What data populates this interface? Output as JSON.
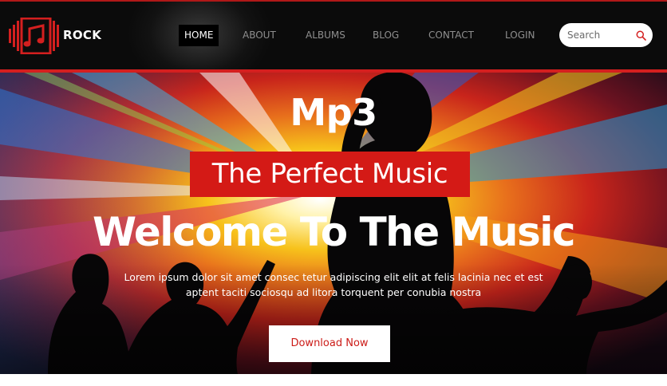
{
  "brand": {
    "name": "ROCK",
    "accent_color": "#d41f1f",
    "logo_icon": "music-note-icon"
  },
  "nav": {
    "items": [
      {
        "label": "HOME",
        "active": true
      },
      {
        "label": "ABOUT",
        "active": false
      },
      {
        "label": "ALBUMS",
        "active": false
      },
      {
        "label": "BLOG",
        "active": false
      },
      {
        "label": "CONTACT",
        "active": false
      },
      {
        "label": "LOGIN",
        "active": false
      }
    ]
  },
  "search": {
    "placeholder": "Search",
    "value": "",
    "icon": "search-icon"
  },
  "hero": {
    "title_small": "Mp3",
    "tagline": "The Perfect Music",
    "heading": "Welcome To The Music",
    "text_line1": "Lorem ipsum dolor sit amet consec tetur adipiscing elit elit at felis lacinia nec et est",
    "text_line2": "aptent taciti sociosqu ad litora torquent per conubia nostra",
    "cta_label": "Download Now"
  }
}
